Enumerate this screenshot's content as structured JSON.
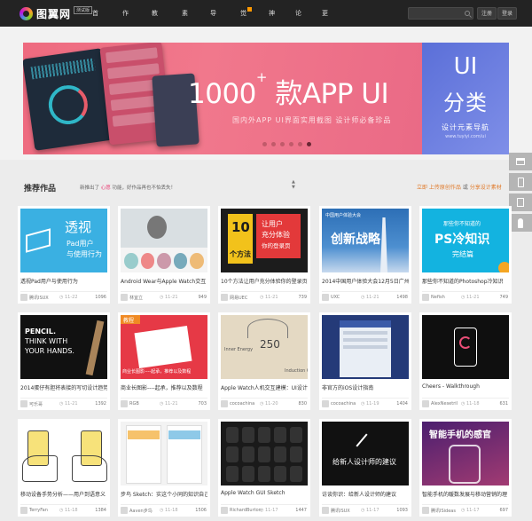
{
  "nav": {
    "logo_text": "图翼网",
    "logo_badge": "测试版",
    "items": [
      {
        "label": "首页",
        "caret": false
      },
      {
        "label": "作品",
        "caret": true
      },
      {
        "label": "教程",
        "caret": true
      },
      {
        "label": "素材",
        "caret": true
      },
      {
        "label": "导航",
        "caret": true
      },
      {
        "label": "觉悟",
        "caret": false,
        "hot": true
      },
      {
        "label": "神器",
        "caret": false
      },
      {
        "label": "论坛",
        "caret": false
      },
      {
        "label": "更多",
        "caret": true
      }
    ],
    "search_placeholder": "",
    "register": "注册",
    "login": "登录"
  },
  "banner": {
    "headline_num": "1000",
    "headline_plus": "+",
    "headline_rest": "款APP UI",
    "subline": "国内外APP UI界面实用截图  设计师必备珍品",
    "dots": 6,
    "active_dot": 6,
    "side": {
      "ui": "UI",
      "cn": "分类",
      "guide": "设计元素导航",
      "url": "www.tuyiyi.com/ui"
    }
  },
  "works": {
    "title": "推荐作品",
    "notice_prefix": "新推出了",
    "notice_highlight": "心愿",
    "notice_suffix": "功能，好作品再也不怕丢失！",
    "link_upload": "立即 上传原创作品",
    "link_or": "或",
    "link_share": "分享设计素材"
  },
  "cards": [
    {
      "title": "透视Pad用户与使用行为",
      "author": "腾讯ISUX",
      "date": "11-22",
      "views": "1096",
      "art": "pad",
      "art_text": [
        "透视",
        "Pad用户",
        "与使用行为"
      ]
    },
    {
      "title": "Android Wear与Apple Watch交互",
      "author": "林宜立",
      "date": "11-21",
      "views": "949",
      "art": "watch"
    },
    {
      "title": "10个方法让用户充分体验你的登录页",
      "author": "网易UEC",
      "date": "11-21",
      "views": "739",
      "art": "ten",
      "art_text": [
        "10",
        "让用户",
        "充分体验",
        "你的登录页",
        "个方法"
      ]
    },
    {
      "title": "2014中国用户体验大会12月5日广州",
      "author": "UXC",
      "date": "11-21",
      "views": "1498",
      "art": "tower",
      "art_text": [
        "中国用户体验大会",
        "创新战略"
      ]
    },
    {
      "title": "那些你不知道的Photoshop冷知识",
      "author": "Nefish",
      "date": "11-21",
      "views": "749",
      "art": "ps",
      "art_text": [
        "那些你不知道的",
        "PS冷知识",
        "完结篇"
      ]
    },
    {
      "title": "2014蛋仔有胆将表接的写切设计趋势",
      "author": "可乐哥",
      "date": "11-21",
      "views": "1392",
      "art": "pencil",
      "art_text": [
        "PENCIL.",
        "THINK WITH",
        "YOUR HANDS."
      ]
    },
    {
      "title": "商业长图影----起承，推荐以及数程",
      "author": "RGB",
      "date": "11-21",
      "views": "703",
      "art": "red",
      "art_text": [
        "教程",
        "商业长图影----起承，推荐以及数程"
      ]
    },
    {
      "title": "Apple Watch人机交互建模：UI设计",
      "author": "cocoachina",
      "date": "11-20",
      "views": "830",
      "art": "beige",
      "art_text": [
        "250",
        "Inner Energy",
        "Induction O"
      ]
    },
    {
      "title": "非官方的iOS设计指南",
      "author": "cocoachina",
      "date": "11-19",
      "views": "1404",
      "art": "ios"
    },
    {
      "title": "Cheers - Walkthrough",
      "author": "AlexNesetril",
      "date": "11-18",
      "views": "631",
      "art": "cheers"
    },
    {
      "title": "移动设备手势分析——用户到语意义",
      "author": "TerryFan",
      "date": "11-18",
      "views": "1384",
      "art": "hands"
    },
    {
      "title": "步鸟 Sketch：实这个小同的知识自己",
      "author": "Aaven步鸟",
      "date": "11-18",
      "views": "1506",
      "art": "sketch"
    },
    {
      "title": "Apple Watch GUI Sketch",
      "author": "RichardBurton",
      "date": "11-17",
      "views": "1447",
      "art": "watchgrid"
    },
    {
      "title": "访谈你识：给新人设计师的建议",
      "author": "腾讯ISUX",
      "date": "11-17",
      "views": "1093",
      "art": "dark",
      "art_text": [
        "给新人设计师的建议"
      ]
    },
    {
      "title": "智能手机的暖数发展与移动营销的理",
      "author": "腾讯ISideas",
      "date": "11-17",
      "views": "697",
      "art": "smart",
      "art_text": [
        "智能手机的感官"
      ]
    }
  ]
}
